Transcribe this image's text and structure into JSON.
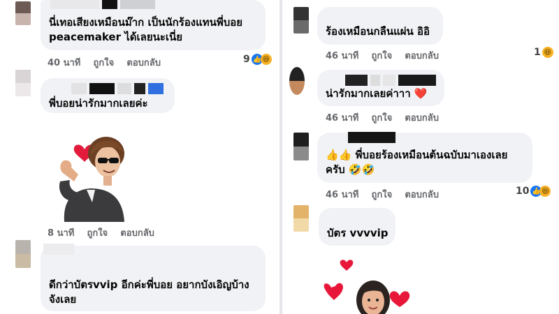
{
  "left": {
    "comments": [
      {
        "text_lines": [
          "นี่เทอเสียงเหมือนม๊าก  เป็นนักร้องแทนพี่บอย",
          "peacemaker ได้เลยนะเนี่ย"
        ],
        "time": "40 นาที",
        "like": "ถูกใจ",
        "reply": "ตอบกลับ",
        "reaction_count": "9",
        "reactions": [
          "like-icon",
          "haha-icon"
        ]
      },
      {
        "text_lines": [
          "พี่บอยน่ารักมากเลยค่ะ"
        ],
        "time": "8 นาที",
        "like": "ถูกใจ",
        "reply": "ตอบกลับ",
        "sticker": "avatar-heart-hands-sticker"
      },
      {
        "text_lines": [
          "ดีกว่าบัตรvvip อีกค่ะพี่บอย อยากบังเอิญบ้าง",
          "จังเลย"
        ]
      }
    ]
  },
  "right": {
    "comments": [
      {
        "text_lines": [
          "ร้องเหมือนกลืนแผ่น อิอิ"
        ],
        "time": "46 นาที",
        "like": "ถูกใจ",
        "reply": "ตอบกลับ",
        "reaction_count": "1",
        "reactions": [
          "haha-icon"
        ]
      },
      {
        "text_lines": [
          "น่ารักมากเลยค่าาา ❤️"
        ],
        "time": "46 นาที",
        "like": "ถูกใจ",
        "reply": "ตอบกลับ"
      },
      {
        "text_lines": [
          "👍👍 พี่บอยร้องเหมือนต้นฉบับมาเองเลย",
          "ครับ 🤣🤣"
        ],
        "time": "46 นาที",
        "like": "ถูกใจ",
        "reply": "ตอบกลับ",
        "reaction_count": "10",
        "reactions": [
          "like-icon",
          "haha-icon"
        ]
      },
      {
        "text_lines": [
          "บัตร vvvvip"
        ],
        "sticker": "avatar-hearts-sticker"
      }
    ]
  },
  "colors": {
    "bubble": "#f0f2f5",
    "meta": "#65676b",
    "like_blue": "#1877f2",
    "heart_red": "#e8173a"
  }
}
